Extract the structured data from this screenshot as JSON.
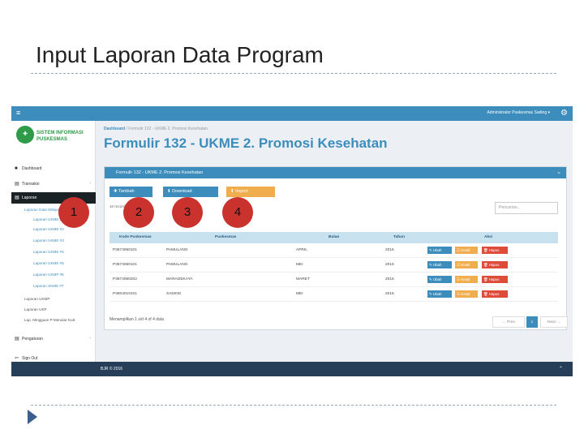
{
  "slide": {
    "title": "Input Laporan Data Program"
  },
  "topbar": {
    "menu_icon": "≡",
    "user_label": "Administrator Puskesmas Sading ▾",
    "gear_icon": "⚙"
  },
  "sidebar": {
    "logo_text": "SISTEM INFORMASI PUSKESMAS",
    "items": [
      {
        "label": "Dashboard",
        "icon": "■"
      },
      {
        "label": "Transaksi",
        "icon": "▤"
      },
      {
        "label": "Laporan",
        "icon": "▤"
      },
      {
        "label": "Laporan Data Wilayah",
        "icon": ""
      },
      {
        "label": "Laporan UKME #1",
        "icon": ""
      },
      {
        "label": "Laporan UKME #2",
        "icon": ""
      },
      {
        "label": "Laporan UKME #3",
        "icon": ""
      },
      {
        "label": "Laporan UKME #4",
        "icon": ""
      },
      {
        "label": "Laporan UKME #5",
        "icon": ""
      },
      {
        "label": "Laporan UKMP #6",
        "icon": ""
      },
      {
        "label": "Laporan SKME #7",
        "icon": ""
      },
      {
        "label": "Laporan UKMP",
        "icon": ""
      },
      {
        "label": "Laporan UKP",
        "icon": ""
      },
      {
        "label": "Lap. Mingguan P Menular KLB",
        "icon": ""
      },
      {
        "label": "Pengaturan",
        "icon": "▤"
      },
      {
        "label": "Sign Out",
        "icon": "⇦"
      }
    ]
  },
  "breadcrumb": {
    "home": "Dashboard",
    "path": "/ Formulir 132 - UKME 2. Promosi Kesehatan"
  },
  "page": {
    "title": "Formulir 132 - UKME 2. Promosi Kesehatan"
  },
  "panel": {
    "title": "Formulir 132 - UKME 2. Promosi Kesehatan",
    "buttons": {
      "tambah": "Tambah",
      "download": "Download",
      "import": "Import"
    },
    "show_entries": "10 records per page",
    "search_placeholder": "Pencarian..."
  },
  "table": {
    "columns": [
      "Kode Puskesmas",
      "Puskesmas",
      "Bulan",
      "Tahun",
      "Aksi"
    ],
    "rows": [
      {
        "kode": "P3674060101",
        "puskesmas": "PAMULANG",
        "bulan": "APRIL",
        "tahun": "2016"
      },
      {
        "kode": "P3674060101",
        "puskesmas": "PAMULANG",
        "bulan": "MEI",
        "tahun": "2016"
      },
      {
        "kode": "P3674060202",
        "puskesmas": "MARADEKAYA",
        "bulan": "MARET",
        "tahun": "2016"
      },
      {
        "kode": "P3604010101",
        "puskesmas": "SADING",
        "bulan": "MEI",
        "tahun": "2016"
      }
    ],
    "action_labels": {
      "ubah": "Ubah",
      "detail": "Detail",
      "hapus": "Hapus"
    },
    "info": "Menampilkan 1 s/d 4 of 4 data",
    "pager": {
      "prev": "← Prev",
      "current": "1",
      "next": "Next →"
    }
  },
  "footer": {
    "text": "BJR © 2016"
  },
  "callouts": [
    "1",
    "2",
    "3",
    "4"
  ],
  "colors": {
    "primary": "#3c8dbc",
    "warning": "#f0ad4e",
    "danger": "#dd4b39",
    "callout": "#c9322d"
  }
}
